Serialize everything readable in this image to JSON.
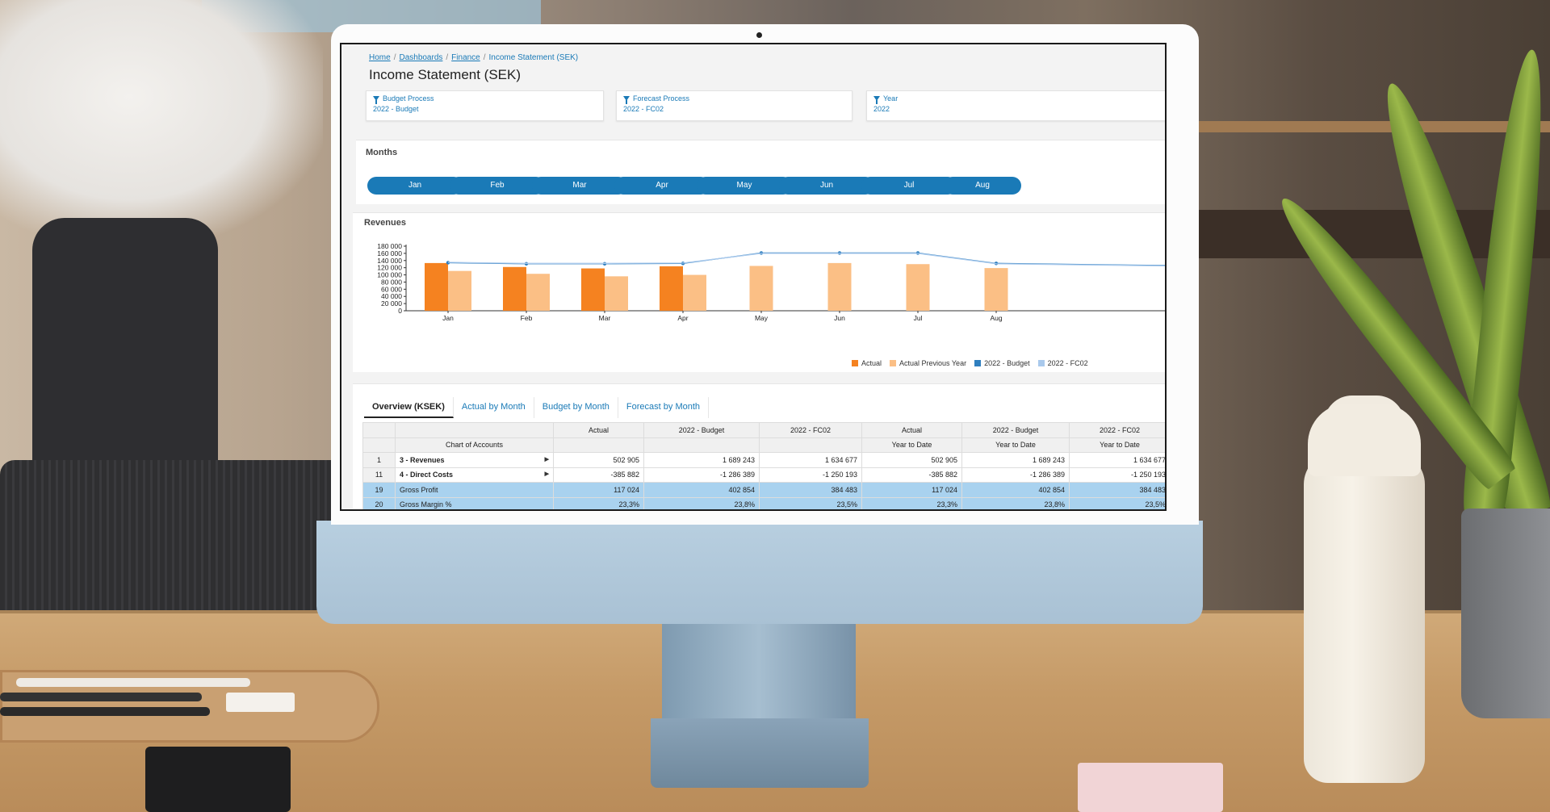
{
  "breadcrumb": {
    "home": "Home",
    "dashboards": "Dashboards",
    "finance": "Finance",
    "current": "Income Statement (SEK)"
  },
  "page_title": "Income Statement (SEK)",
  "filters": [
    {
      "label": "Budget Process",
      "value": "2022 - Budget"
    },
    {
      "label": "Forecast Process",
      "value": "2022 - FC02"
    },
    {
      "label": "Year",
      "value": "2022"
    }
  ],
  "months_panel": {
    "title": "Months",
    "months": [
      "Jan",
      "Feb",
      "Mar",
      "Apr",
      "May",
      "Jun",
      "Jul",
      "Aug"
    ]
  },
  "revenues_panel": {
    "title": "Revenues"
  },
  "chart_data": {
    "type": "bar",
    "title": "Revenues",
    "categories": [
      "Jan",
      "Feb",
      "Mar",
      "Apr",
      "May",
      "Jun",
      "Jul",
      "Aug"
    ],
    "y_ticks": [
      "0",
      "20 000",
      "40 000",
      "60 000",
      "80 000",
      "100 000",
      "120 000",
      "140 000",
      "160 000",
      "180 000"
    ],
    "ylim": [
      0,
      180000
    ],
    "series": [
      {
        "name": "Actual",
        "kind": "bar",
        "color": "#f58220",
        "values": [
          133000,
          122000,
          118000,
          124000,
          null,
          null,
          null,
          null
        ]
      },
      {
        "name": "Actual Previous Year",
        "kind": "bar",
        "color": "#fbbf85",
        "values": [
          111000,
          103000,
          96000,
          100000,
          125000,
          133000,
          130000,
          119000
        ]
      },
      {
        "name": "2022 - Budget",
        "kind": "line",
        "color": "#2f7fbf",
        "values": [
          134000,
          131000,
          131000,
          132000,
          161000,
          161000,
          161000,
          132000
        ]
      },
      {
        "name": "2022 - FC02",
        "kind": "line",
        "color": "#a9c9ec",
        "values": [
          135000,
          132000,
          132000,
          133000,
          160000,
          160000,
          160000,
          131000
        ]
      }
    ],
    "legend_position": "bottom-right",
    "grid": false
  },
  "tabs": [
    {
      "label": "Overview (KSEK)",
      "active": true
    },
    {
      "label": "Actual by Month",
      "active": false
    },
    {
      "label": "Budget by Month",
      "active": false
    },
    {
      "label": "Forecast by Month",
      "active": false
    }
  ],
  "table": {
    "header_row1": [
      "",
      "",
      "Actual",
      "2022 - Budget",
      "2022 - FC02",
      "Actual",
      "2022 - Budget",
      "2022 - FC02"
    ],
    "header_row2": [
      "",
      "Chart of Accounts",
      "",
      "",
      "",
      "Year to Date",
      "Year to Date",
      "Year to Date"
    ],
    "rows": [
      {
        "idx": "1",
        "account": "3 - Revenues",
        "expandable": true,
        "bold": true,
        "highlight": false,
        "values": [
          "502 905",
          "1 689 243",
          "1 634 677",
          "502 905",
          "1 689 243",
          "1 634 677"
        ]
      },
      {
        "idx": "11",
        "account": "4 - Direct Costs",
        "expandable": true,
        "bold": true,
        "highlight": false,
        "values": [
          "-385 882",
          "-1 286 389",
          "-1 250 193",
          "-385 882",
          "-1 286 389",
          "-1 250 193"
        ]
      },
      {
        "idx": "19",
        "account": "Gross Profit",
        "expandable": false,
        "bold": false,
        "highlight": true,
        "values": [
          "117 024",
          "402 854",
          "384 483",
          "117 024",
          "402 854",
          "384 483"
        ]
      },
      {
        "idx": "20",
        "account": "Gross Margin %",
        "expandable": false,
        "bold": false,
        "highlight": true,
        "values": [
          "23,3%",
          "23,8%",
          "23,5%",
          "23,3%",
          "23,8%",
          "23,5%"
        ]
      }
    ]
  }
}
